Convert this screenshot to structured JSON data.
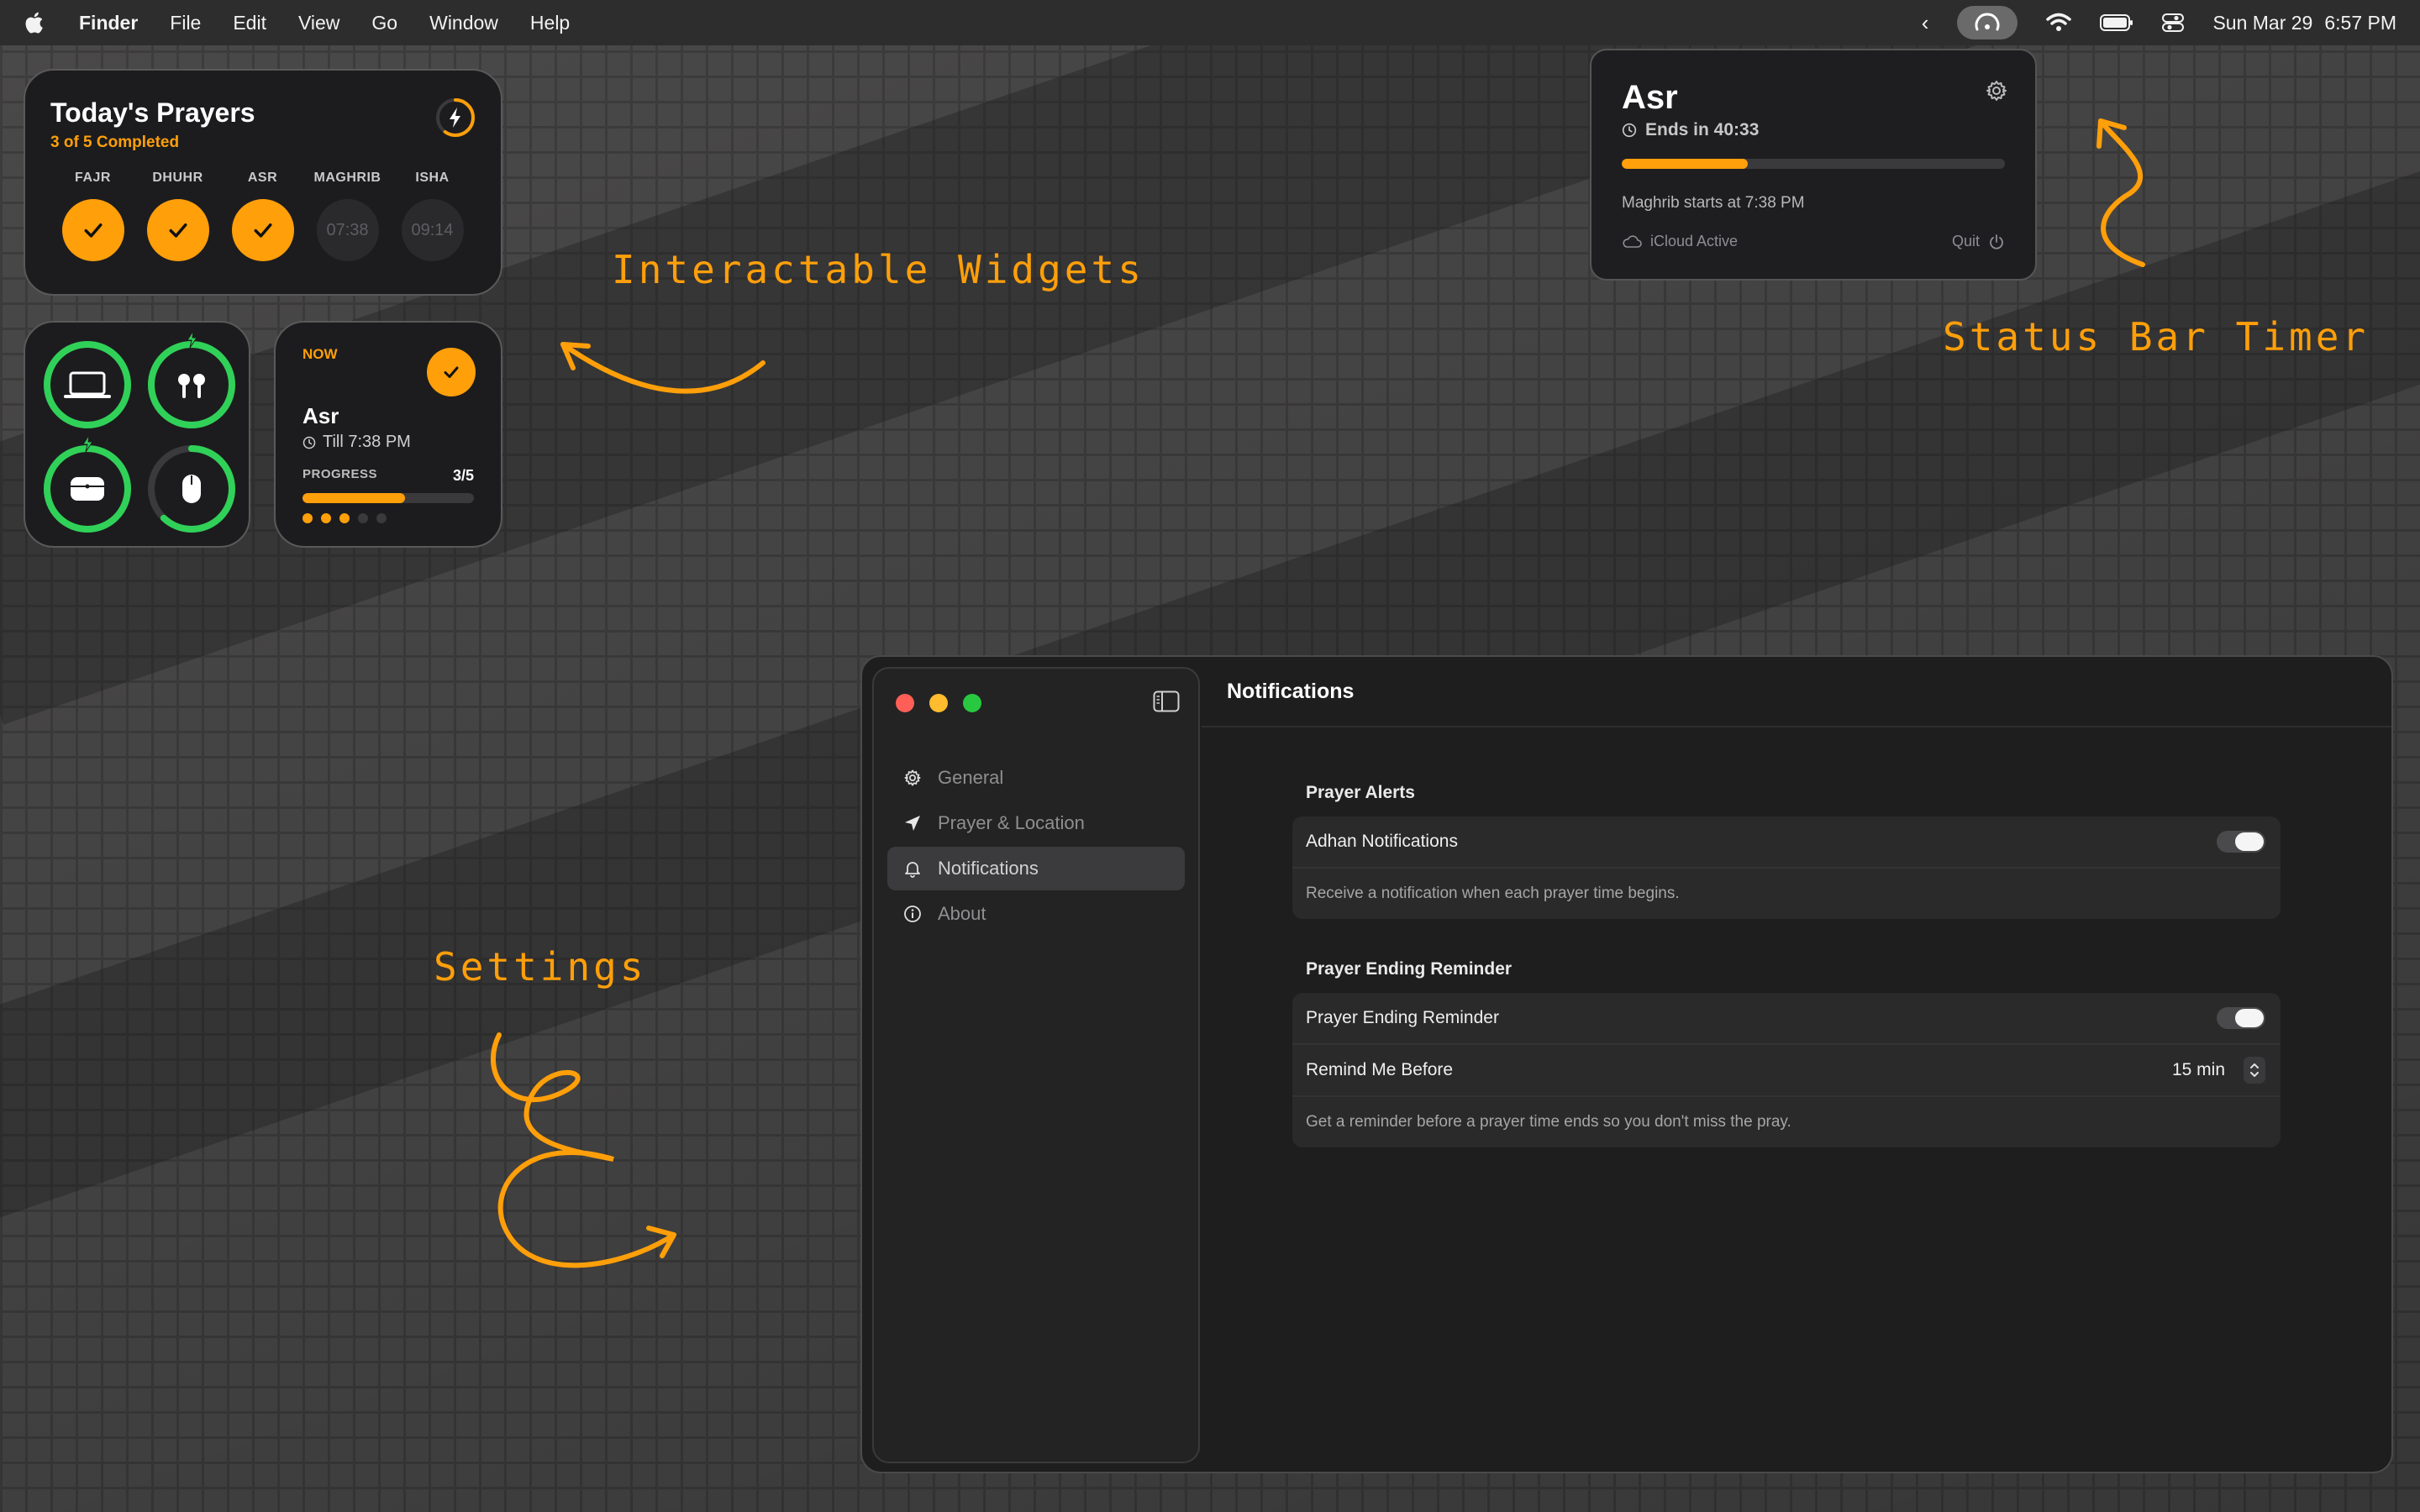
{
  "menubar": {
    "app_name": "Finder",
    "menus": [
      "File",
      "Edit",
      "View",
      "Go",
      "Window",
      "Help"
    ],
    "date": "Sun Mar 29",
    "time": "6:57 PM"
  },
  "todays_prayers": {
    "title": "Today's Prayers",
    "subtitle": "3 of 5 Completed",
    "prayers": [
      {
        "name": "FAJR",
        "status": "done",
        "time": ""
      },
      {
        "name": "DHUHR",
        "status": "done",
        "time": ""
      },
      {
        "name": "ASR",
        "status": "done",
        "time": ""
      },
      {
        "name": "MAGHRIB",
        "status": "pending",
        "time": "07:38"
      },
      {
        "name": "ISHA",
        "status": "pending",
        "time": "09:14"
      }
    ]
  },
  "batteries": {
    "devices": [
      {
        "icon": "laptop-icon",
        "level": 1.0,
        "charging": false
      },
      {
        "icon": "airpods-icon",
        "level": 1.0,
        "charging": true
      },
      {
        "icon": "airpods-case-icon",
        "level": 1.0,
        "charging": true
      },
      {
        "icon": "mouse-icon",
        "level": 0.62,
        "charging": false
      }
    ]
  },
  "now_widget": {
    "label": "NOW",
    "prayer": "Asr",
    "till": "Till 7:38 PM",
    "progress_label": "PROGRESS",
    "progress_count": "3/5",
    "progress_fraction": 0.6,
    "dots_done": 3,
    "dots_total": 5
  },
  "timer": {
    "prayer": "Asr",
    "ends": "Ends in 40:33",
    "progress_fraction": 0.33,
    "next": "Maghrib starts at 7:38 PM",
    "icloud": "iCloud Active",
    "quit": "Quit"
  },
  "annotations": {
    "widgets": "Interactable Widgets",
    "status_bar": "Status Bar Timer",
    "settings": "Settings"
  },
  "settings": {
    "header": "Notifications",
    "nav": [
      {
        "label": "General",
        "icon": "gear-icon",
        "active": false
      },
      {
        "label": "Prayer & Location",
        "icon": "location-arrow-icon",
        "active": false
      },
      {
        "label": "Notifications",
        "icon": "bell-icon",
        "active": true
      },
      {
        "label": "About",
        "icon": "info-icon",
        "active": false
      }
    ],
    "alerts": {
      "title": "Prayer Alerts",
      "adhan_label": "Adhan Notifications",
      "adhan_enabled": true,
      "description": "Receive a notification when each prayer time begins."
    },
    "ending": {
      "title": "Prayer Ending Reminder",
      "toggle_label": "Prayer Ending Reminder",
      "toggle_enabled": true,
      "remind_label": "Remind Me Before",
      "remind_value": "15 min",
      "description": "Get a reminder before a prayer time ends so you don't miss the pray."
    }
  },
  "colors": {
    "accent": "#ff9f0a",
    "battery_green": "#30d158",
    "window_close": "#ff5f57",
    "window_minimize": "#febc2e",
    "window_zoom": "#28c840"
  }
}
